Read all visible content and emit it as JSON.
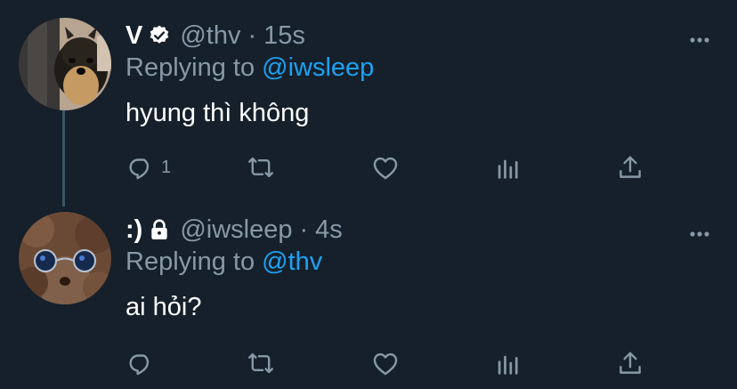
{
  "tweets": [
    {
      "display_name": "V",
      "badge": "verified-icon",
      "handle": "@thv",
      "separator": "·",
      "time": "15s",
      "replying_prefix": "Replying to",
      "replying_to": "@iwsleep",
      "text": "hyung thì không",
      "reply_count": "1",
      "retweet_count": "",
      "like_count": ""
    },
    {
      "display_name": ":)",
      "badge": "lock-icon",
      "handle": "@iwsleep",
      "separator": "·",
      "time": "4s",
      "replying_prefix": "Replying to",
      "replying_to": "@thv",
      "text": "ai hỏi?",
      "reply_count": "",
      "retweet_count": "",
      "like_count": ""
    }
  ],
  "colors": {
    "background": "#15202b",
    "secondary_text": "#8899a6",
    "accent": "#1da1f2",
    "thread_line": "#3d5466"
  }
}
